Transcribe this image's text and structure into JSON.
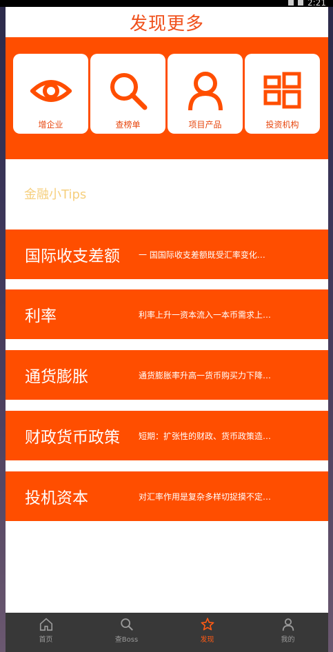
{
  "status": {
    "time": "2:21"
  },
  "header": {
    "title": "发现更多"
  },
  "features": [
    {
      "label": "增企业",
      "icon": "eye-icon"
    },
    {
      "label": "查榜单",
      "icon": "search-icon"
    },
    {
      "label": "项目产品",
      "icon": "person-icon"
    },
    {
      "label": "投资机构",
      "icon": "grid-icon"
    }
  ],
  "tips": {
    "heading": "金融小Tips",
    "items": [
      {
        "title": "国际收支差额",
        "desc": "一 国国际收支差额既受汇率变化…"
      },
      {
        "title": "利率",
        "desc": "利率上升一资本流入一本币需求上…"
      },
      {
        "title": "通货膨胀",
        "desc": "通货膨胀率升高一货币购买力下降…"
      },
      {
        "title": "财政货币政策",
        "desc": "短期：扩张性的财政、货币政策造…"
      },
      {
        "title": "投机资本",
        "desc": "对汇率作用是复杂多样切捉摸不定…"
      }
    ]
  },
  "nav": [
    {
      "label": "首页",
      "icon": "home-icon",
      "active": false
    },
    {
      "label": "查Boss",
      "icon": "search-icon",
      "active": false
    },
    {
      "label": "发现",
      "icon": "star-icon",
      "active": true
    },
    {
      "label": "我的",
      "icon": "user-icon",
      "active": false
    }
  ],
  "colors": {
    "accent": "#ff4e00",
    "title": "#f0511c",
    "tips_heading": "#f6cf7d",
    "nav_bg": "#383838"
  }
}
